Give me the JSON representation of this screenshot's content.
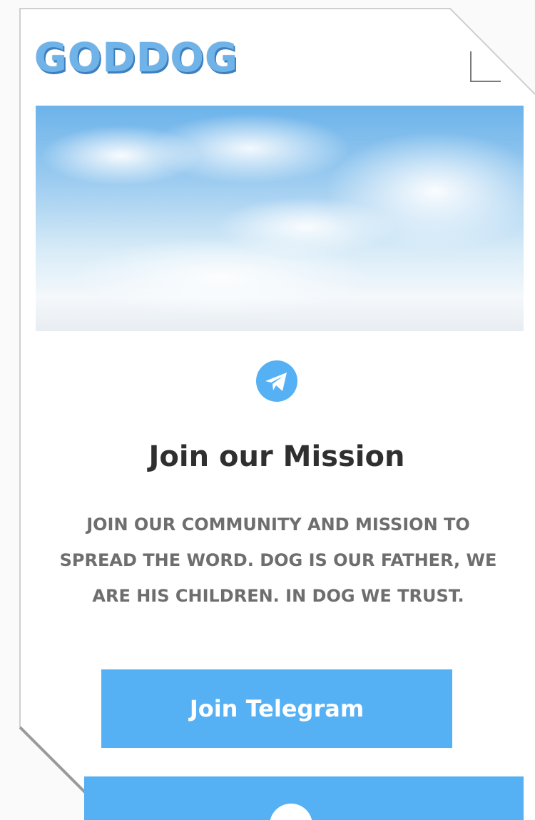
{
  "header": {
    "logo_text": "GODDOG",
    "menu_icon": "menu-icon"
  },
  "hero": {
    "image": "sky-with-clouds"
  },
  "mission": {
    "icon": "telegram-icon",
    "title": "Join our Mission",
    "description": "Join our community and mission to spread the word. Dog is our father, we are his children. In Dog we trust.",
    "button_label": "Join Telegram"
  },
  "colors": {
    "accent": "#55b0f4",
    "logo": "#6fb3e8",
    "heading": "#2f2f2f",
    "body_text": "#6e6e6e"
  }
}
